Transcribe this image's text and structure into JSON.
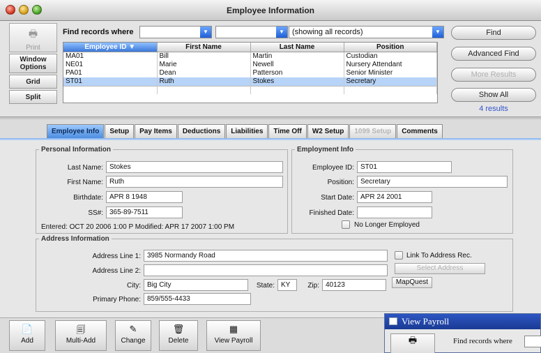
{
  "window": {
    "title": "Employee Information"
  },
  "find": {
    "label": "Find records where",
    "select1": "",
    "select2": "",
    "select3": "(showing all records)",
    "buttons": {
      "find": "Find",
      "advanced": "Advanced Find",
      "more": "More Results",
      "show_all": "Show All"
    },
    "results": "4 results"
  },
  "left_tools": {
    "print": "Print",
    "window_options": "Window Options",
    "grid": "Grid",
    "split": "Split"
  },
  "grid": {
    "columns": [
      "Employee ID",
      "First Name",
      "Last Name",
      "Position"
    ],
    "rows": [
      [
        "MA01",
        "Bill",
        "Martin",
        "Custodian"
      ],
      [
        "NE01",
        "Marie",
        "Newell",
        "Nursery Attendant"
      ],
      [
        "PA01",
        "Dean",
        "Patterson",
        "Senior Minister"
      ],
      [
        "ST01",
        "Ruth",
        "Stokes",
        "Secretary"
      ]
    ]
  },
  "tabs": [
    "Employee Info",
    "Setup",
    "Pay Items",
    "Deductions",
    "Liabilities",
    "Time Off",
    "W2 Setup",
    "1099 Setup",
    "Comments"
  ],
  "personal": {
    "legend": "Personal Information",
    "last_name_label": "Last Name:",
    "last_name": "Stokes",
    "first_name_label": "First Name:",
    "first_name": "Ruth",
    "birthdate_label": "Birthdate:",
    "birthdate": "APR 8 1948",
    "ssn_label": "SS#:",
    "ssn": "365-89-7511",
    "entered": "Entered:  OCT 20 2006 1:00 P  Modified:  APR 17 2007 1:00 PM"
  },
  "employment": {
    "legend": "Employment Info",
    "id_label": "Employee ID:",
    "id": "ST01",
    "position_label": "Position:",
    "position": "Secretary",
    "start_label": "Start Date:",
    "start": "APR 24 2001",
    "finished_label": "Finished Date:",
    "finished": "",
    "no_longer_label": "No Longer Employed"
  },
  "address": {
    "legend": "Address Information",
    "line1_label": "Address Line 1:",
    "line1": "3985 Normandy Road",
    "line2_label": "Address Line 2:",
    "line2": "",
    "city_label": "City:",
    "city": "Big City",
    "state_label": "State:",
    "state": "KY",
    "zip_label": "Zip:",
    "zip": "40123",
    "phone_label": "Primary Phone:",
    "phone": "859/555-4433",
    "link_label": "Link To Address Rec.",
    "select_address": "Select Address",
    "mapquest": "MapQuest"
  },
  "bottom": {
    "add": "Add",
    "multi_add": "Multi-Add",
    "change": "Change",
    "delete": "Delete",
    "view_payroll": "View Payroll"
  },
  "payroll_window": {
    "title": "View Payroll",
    "find_label": "Find records where"
  }
}
